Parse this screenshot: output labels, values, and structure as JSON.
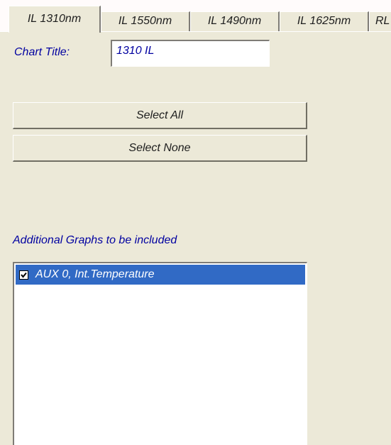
{
  "tabs": [
    {
      "label": "IL 1310nm",
      "active": true
    },
    {
      "label": "IL 1550nm",
      "active": false
    },
    {
      "label": "IL 1490nm",
      "active": false
    },
    {
      "label": "IL 1625nm",
      "active": false
    },
    {
      "label": "RL",
      "active": false
    }
  ],
  "chart_title": {
    "label": "Chart Title:",
    "value": "1310 IL"
  },
  "buttons": {
    "select_all": "Select All",
    "select_none": "Select None"
  },
  "additional_graphs": {
    "label": "Additional Graphs to be included",
    "items": [
      {
        "label": "AUX 0, Int.Temperature",
        "checked": true,
        "selected": true
      }
    ]
  },
  "colors": {
    "panel_bg": "#ece9d8",
    "label_text": "#0000a0",
    "selection_bg": "#316ac5"
  }
}
